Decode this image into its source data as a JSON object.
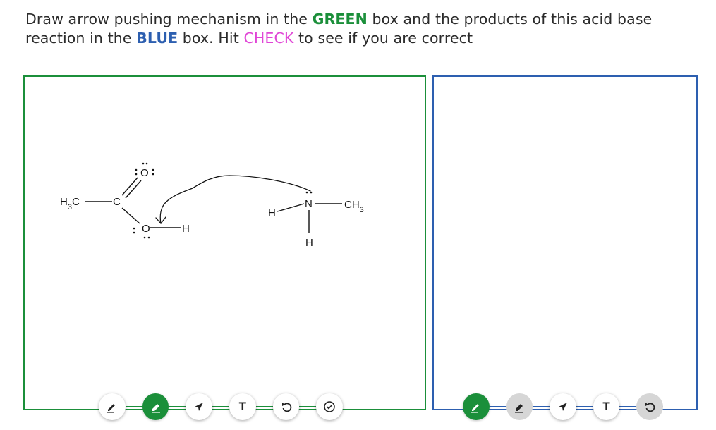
{
  "instructions": {
    "part1": "Draw arrow pushing mechanism in the ",
    "green_word": "GREEN",
    "part2": " box and the products of this acid base reaction in the ",
    "blue_word": "BLUE",
    "part3": " box. Hit ",
    "check_word": "CHECK",
    "part4": " to see if you are correct"
  },
  "colors": {
    "green": "#1b8f3a",
    "blue": "#2d5fb0",
    "pink": "#e045d6",
    "disabled_gray": "#d6d6d6"
  },
  "molecule": {
    "acetic_acid": {
      "methyl": "H3C",
      "carbon": "C",
      "carbonyl_oxygen": "O",
      "hydroxyl_oxygen": "O",
      "acidic_hydrogen": "H"
    },
    "methylamine": {
      "nitrogen": "N",
      "hydrogen_left": "H",
      "hydrogen_bottom": "H",
      "methyl": "CH3"
    }
  },
  "green_toolbar": [
    {
      "name": "pencil-button",
      "icon": "pencil-icon",
      "state": "normal"
    },
    {
      "name": "eraser-button",
      "icon": "eraser-icon",
      "state": "active"
    },
    {
      "name": "pointer-button",
      "icon": "pointer-arrow-icon",
      "state": "normal"
    },
    {
      "name": "text-button",
      "icon": "text-icon",
      "label": "T",
      "state": "normal"
    },
    {
      "name": "undo-button",
      "icon": "undo-icon",
      "state": "normal"
    },
    {
      "name": "check-button",
      "icon": "check-circle-icon",
      "state": "normal"
    }
  ],
  "blue_toolbar": [
    {
      "name": "pencil-button",
      "icon": "pencil-icon",
      "state": "active"
    },
    {
      "name": "eraser-button",
      "icon": "eraser-icon",
      "state": "disabled"
    },
    {
      "name": "pointer-button",
      "icon": "pointer-arrow-icon",
      "state": "normal"
    },
    {
      "name": "text-button",
      "icon": "text-icon",
      "label": "T",
      "state": "normal"
    },
    {
      "name": "undo-button",
      "icon": "undo-icon",
      "state": "disabled"
    }
  ]
}
